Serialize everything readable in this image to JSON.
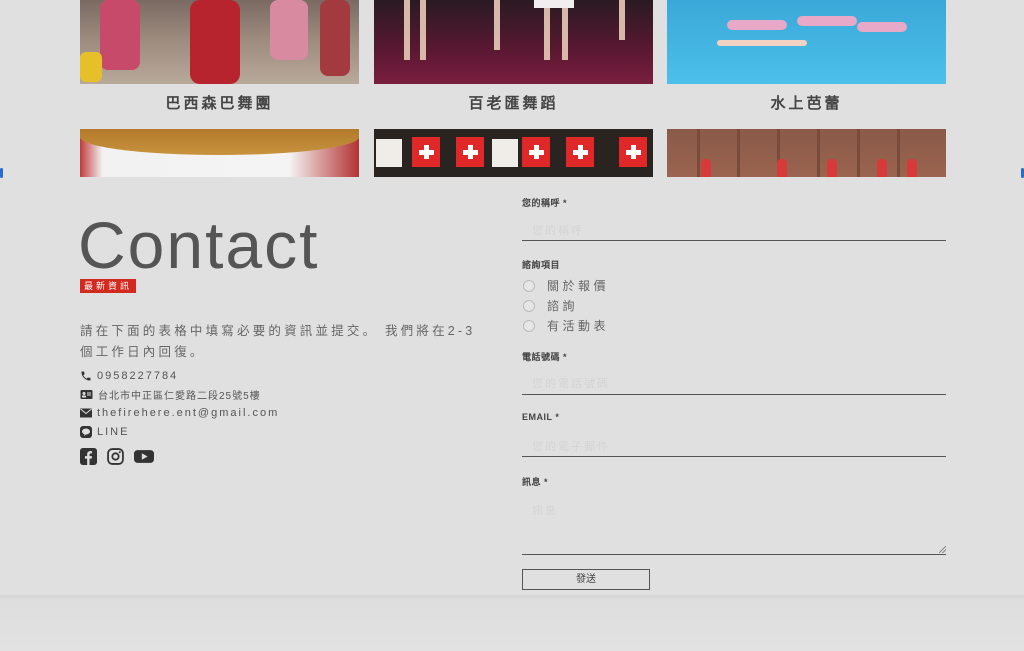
{
  "gallery": {
    "items": [
      {
        "caption": "巴西森巴舞團"
      },
      {
        "caption": "百老匯舞蹈"
      },
      {
        "caption": "水上芭蕾"
      }
    ]
  },
  "contact": {
    "title": "Contact",
    "badge": "最新資訊",
    "intro": "請在下面的表格中填寫必要的資訊並提交。 我們將在2-3 個工作日內回復。",
    "phone": "0958227784",
    "address": "台北市中正區仁愛路二段25號5樓",
    "email": "thefirehere.ent@gmail.com",
    "line": "LINE",
    "socials": [
      "facebook-icon",
      "instagram-icon",
      "youtube-icon"
    ]
  },
  "form": {
    "name_label": "您的稱呼 *",
    "name_placeholder": "您的稱呼",
    "inquiry_label": "諮詢項目",
    "inquiry_options": [
      "關於報價",
      "諮詢",
      "有活動表"
    ],
    "phone_label": "電話號碼 *",
    "phone_placeholder": "您的電話號碼",
    "email_label": "EMAIL *",
    "email_placeholder": "您的電子郵件",
    "message_label": "訊息 *",
    "message_placeholder": "訊息",
    "submit_label": "發送"
  },
  "colors": {
    "background": "#e0e0e0",
    "badge": "#d22a1e",
    "text": "#555555"
  }
}
